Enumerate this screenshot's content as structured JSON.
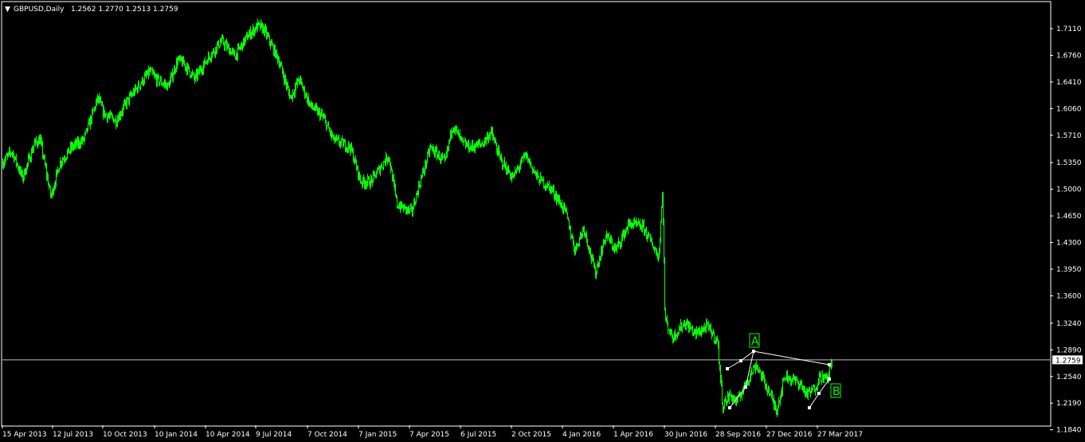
{
  "header": {
    "dropdown_glyph": "▼",
    "symbol": "GBPUSD,Daily",
    "ohlc": "1.2562 1.2770 1.2513 1.2759"
  },
  "colors": {
    "background": "#000000",
    "frame": "#ffffff",
    "bullish_candle": "#00ff00",
    "bearish_candle": "#00ff00",
    "price_line": "#c0c0c0",
    "pattern_lines": "#ffffff",
    "wave_labels": "#00ff00"
  },
  "chart_data": {
    "type": "candlestick",
    "symbol": "GBPUSD",
    "timeframe": "Daily",
    "current_price": "1.2759",
    "current_price_value": 1.2759,
    "y_ticks": [
      "1.7110",
      "1.6760",
      "1.6410",
      "1.6060",
      "1.5710",
      "1.5350",
      "1.5000",
      "1.4650",
      "1.4300",
      "1.3950",
      "1.3600",
      "1.3240",
      "1.2890",
      "1.2540",
      "1.2190",
      "1.1840"
    ],
    "x_ticks": [
      "15 Apr 2013",
      "12 Jul 2013",
      "10 Oct 2013",
      "10 Jan 2014",
      "10 Apr 2014",
      "9 Jul 2014",
      "7 Oct 2014",
      "7 Jan 2015",
      "7 Apr 2015",
      "6 Jul 2015",
      "2 Oct 2015",
      "4 Jan 2016",
      "1 Apr 2016",
      "30 Jun 2016",
      "28 Sep 2016",
      "27 Dec 2016",
      "27 Mar 2017"
    ],
    "ylim": [
      1.174,
      1.735
    ],
    "grid": false,
    "series": [
      {
        "values": [
          [
            "2013-04-15",
            1.535
          ],
          [
            "2013-05-01",
            1.55
          ],
          [
            "2013-05-20",
            1.515
          ],
          [
            "2013-06-10",
            1.56
          ],
          [
            "2013-06-20",
            1.565
          ],
          [
            "2013-07-09",
            1.49
          ],
          [
            "2013-07-25",
            1.535
          ],
          [
            "2013-08-15",
            1.555
          ],
          [
            "2013-09-05",
            1.565
          ],
          [
            "2013-09-30",
            1.62
          ],
          [
            "2013-10-10",
            1.6
          ],
          [
            "2013-11-01",
            1.59
          ],
          [
            "2013-11-20",
            1.615
          ],
          [
            "2013-12-10",
            1.635
          ],
          [
            "2013-12-31",
            1.655
          ],
          [
            "2014-01-10",
            1.645
          ],
          [
            "2014-02-01",
            1.635
          ],
          [
            "2014-02-18",
            1.67
          ],
          [
            "2014-03-01",
            1.665
          ],
          [
            "2014-03-20",
            1.645
          ],
          [
            "2014-04-10",
            1.67
          ],
          [
            "2014-05-06",
            1.695
          ],
          [
            "2014-05-30",
            1.675
          ],
          [
            "2014-06-20",
            1.7
          ],
          [
            "2014-07-09",
            1.715
          ],
          [
            "2014-07-20",
            1.71
          ],
          [
            "2014-08-15",
            1.67
          ],
          [
            "2014-09-05",
            1.62
          ],
          [
            "2014-09-20",
            1.645
          ],
          [
            "2014-10-10",
            1.61
          ],
          [
            "2014-11-01",
            1.595
          ],
          [
            "2014-11-20",
            1.565
          ],
          [
            "2014-12-20",
            1.555
          ],
          [
            "2015-01-07",
            1.51
          ],
          [
            "2015-01-25",
            1.51
          ],
          [
            "2015-02-25",
            1.545
          ],
          [
            "2015-03-12",
            1.48
          ],
          [
            "2015-04-07",
            1.47
          ],
          [
            "2015-04-20",
            1.505
          ],
          [
            "2015-05-10",
            1.555
          ],
          [
            "2015-06-05",
            1.535
          ],
          [
            "2015-06-18",
            1.585
          ],
          [
            "2015-07-06",
            1.56
          ],
          [
            "2015-07-20",
            1.555
          ],
          [
            "2015-08-10",
            1.56
          ],
          [
            "2015-08-25",
            1.575
          ],
          [
            "2015-09-10",
            1.54
          ],
          [
            "2015-10-02",
            1.515
          ],
          [
            "2015-10-25",
            1.545
          ],
          [
            "2015-11-15",
            1.515
          ],
          [
            "2015-12-10",
            1.5
          ],
          [
            "2016-01-04",
            1.47
          ],
          [
            "2016-01-20",
            1.42
          ],
          [
            "2016-02-05",
            1.45
          ],
          [
            "2016-02-25",
            1.39
          ],
          [
            "2016-03-15",
            1.44
          ],
          [
            "2016-04-01",
            1.42
          ],
          [
            "2016-04-25",
            1.455
          ],
          [
            "2016-05-20",
            1.45
          ],
          [
            "2016-06-10",
            1.42
          ],
          [
            "2016-06-16",
            1.41
          ],
          [
            "2016-06-23",
            1.5
          ],
          [
            "2016-06-27",
            1.33
          ],
          [
            "2016-07-10",
            1.305
          ],
          [
            "2016-08-01",
            1.325
          ],
          [
            "2016-08-20",
            1.31
          ],
          [
            "2016-09-10",
            1.32
          ],
          [
            "2016-09-28",
            1.3
          ],
          [
            "2016-10-07",
            1.215
          ],
          [
            "2016-10-20",
            1.23
          ],
          [
            "2016-11-01",
            1.22
          ],
          [
            "2016-11-20",
            1.25
          ],
          [
            "2016-12-05",
            1.27
          ],
          [
            "2016-12-27",
            1.235
          ],
          [
            "2017-01-10",
            1.21
          ],
          [
            "2017-01-25",
            1.255
          ],
          [
            "2017-02-20",
            1.245
          ],
          [
            "2017-03-05",
            1.23
          ],
          [
            "2017-03-20",
            1.24
          ],
          [
            "2017-03-27",
            1.255
          ],
          [
            "2017-04-10",
            1.25
          ],
          [
            "2017-04-18",
            1.2759
          ]
        ]
      }
    ],
    "annotations": [
      {
        "label": "A"
      },
      {
        "label": "B"
      }
    ]
  }
}
